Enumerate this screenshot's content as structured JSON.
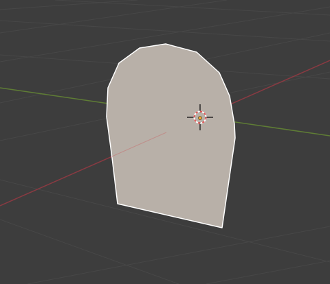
{
  "viewport": {
    "name": "3D Viewport",
    "background_color": "#3d3d3d",
    "grid_color": "#4a4a4a",
    "x_axis_color": "#8a3a42",
    "y_axis_color": "#5f7d35"
  },
  "object": {
    "type": "plane",
    "face_color": "#b8b0a8",
    "edge_color": "#ffffff",
    "selected": true
  },
  "cursor": {
    "icon": "3d-cursor-icon",
    "ring_colors": [
      "#e05656",
      "#ffffff"
    ],
    "crosshair_color": "#111111"
  },
  "origin": {
    "icon": "origin-point-icon",
    "color": "#f0a830"
  }
}
